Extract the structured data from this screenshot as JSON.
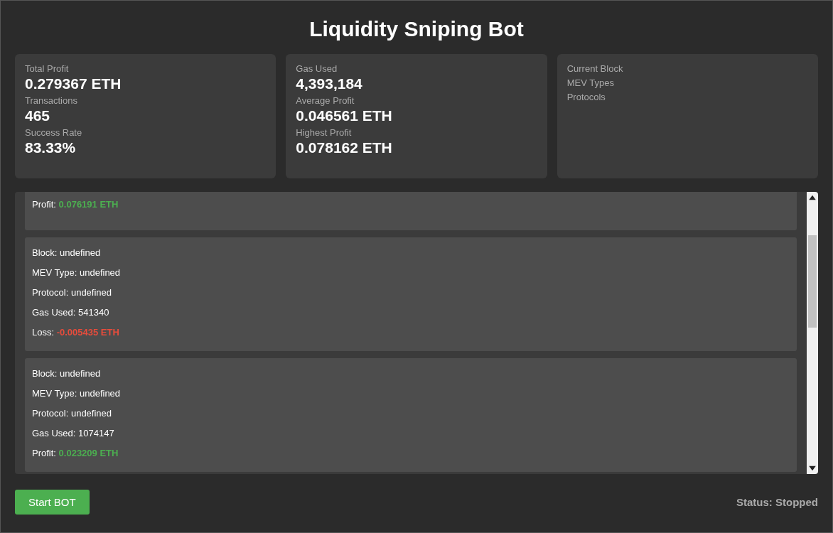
{
  "title": "Liquidity Sniping Bot",
  "stat_cards": [
    {
      "stats": [
        {
          "label": "Total Profit",
          "value": "0.279367 ETH"
        },
        {
          "label": "Transactions",
          "value": "465"
        },
        {
          "label": "Success Rate",
          "value": "83.33%"
        }
      ]
    },
    {
      "stats": [
        {
          "label": "Gas Used",
          "value": "4,393,184"
        },
        {
          "label": "Average Profit",
          "value": "0.046561 ETH"
        },
        {
          "label": "Highest Profit",
          "value": "0.078162 ETH"
        }
      ]
    },
    {
      "stats": [
        {
          "label": "Current Block"
        },
        {
          "label": "MEV Types"
        },
        {
          "label": "Protocols"
        }
      ]
    }
  ],
  "log_entries": [
    {
      "lines": [
        {
          "kind": "profit",
          "label": "Profit:",
          "value": "0.076191 ETH"
        }
      ]
    },
    {
      "lines": [
        {
          "kind": "plain",
          "label": "Block:",
          "value": "undefined"
        },
        {
          "kind": "plain",
          "label": "MEV Type:",
          "value": "undefined"
        },
        {
          "kind": "plain",
          "label": "Protocol:",
          "value": "undefined"
        },
        {
          "kind": "plain",
          "label": "Gas Used:",
          "value": "541340"
        },
        {
          "kind": "loss",
          "label": "Loss:",
          "value": "-0.005435 ETH"
        }
      ]
    },
    {
      "lines": [
        {
          "kind": "plain",
          "label": "Block:",
          "value": "undefined"
        },
        {
          "kind": "plain",
          "label": "MEV Type:",
          "value": "undefined"
        },
        {
          "kind": "plain",
          "label": "Protocol:",
          "value": "undefined"
        },
        {
          "kind": "plain",
          "label": "Gas Used:",
          "value": "1074147"
        },
        {
          "kind": "profit",
          "label": "Profit:",
          "value": "0.023209 ETH"
        }
      ]
    }
  ],
  "start_button": "Start BOT",
  "status": "Status: Stopped"
}
